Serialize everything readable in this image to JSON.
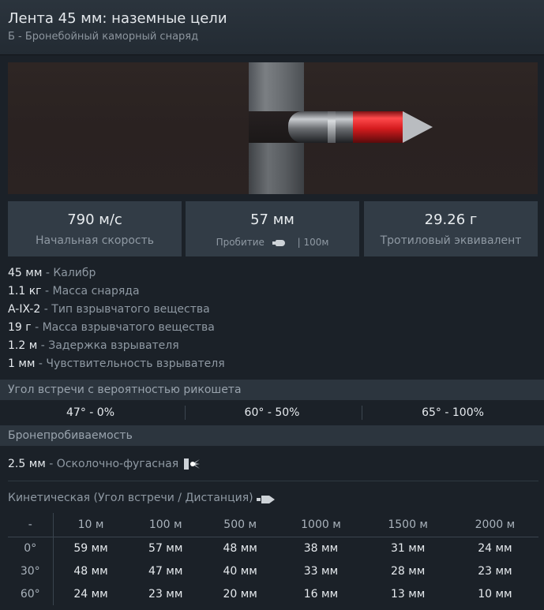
{
  "header": {
    "title": "Лента 45 мм: наземные цели",
    "subtitle": "Б - Бронебойный каморный снаряд"
  },
  "stats": [
    {
      "value": "790 м/с",
      "label": "Начальная скорость"
    },
    {
      "value": "57 мм",
      "label_prefix": "Пробитие",
      "label_suffix": "| 100м"
    },
    {
      "value": "29.26 г",
      "label": "Тротиловый эквивалент"
    }
  ],
  "properties": [
    {
      "value": "45 мм",
      "label": " - Калибр"
    },
    {
      "value": "1.1 кг",
      "label": " - Масса снаряда"
    },
    {
      "value": "A-IX-2",
      "label": " - Тип взрывчатого вещества"
    },
    {
      "value": "19 г",
      "label": " - Масса взрывчатого вещества"
    },
    {
      "value": "1.2 м",
      "label": " - Задержка взрывателя"
    },
    {
      "value": "1 мм",
      "label": " - Чувствительность взрывателя"
    }
  ],
  "ricochet": {
    "title": "Угол встречи с вероятностью рикошета",
    "cells": [
      {
        "angle": "47°",
        "prob": " - 0%"
      },
      {
        "angle": "60°",
        "prob": " - 50%"
      },
      {
        "angle": "65°",
        "prob": " - 100%"
      }
    ]
  },
  "armor": {
    "title": "Бронепробиваемость",
    "he_value": "2.5 мм",
    "he_label": " - Осколочно-фугасная",
    "kinetic_title": "Кинетическая (Угол встречи / Дистанция)",
    "table": {
      "corner": "-",
      "distances": [
        "10 м",
        "100 м",
        "500 м",
        "1000 м",
        "1500 м",
        "2000 м"
      ],
      "rows": [
        {
          "angle": "0°",
          "values": [
            "59 мм",
            "57 мм",
            "48 мм",
            "38 мм",
            "31 мм",
            "24 мм"
          ]
        },
        {
          "angle": "30°",
          "values": [
            "48 мм",
            "47 мм",
            "40 мм",
            "33 мм",
            "28 мм",
            "23 мм"
          ]
        },
        {
          "angle": "60°",
          "values": [
            "24 мм",
            "23 мм",
            "20 мм",
            "16 мм",
            "13 мм",
            "10 мм"
          ]
        }
      ]
    }
  },
  "icons": {
    "penetration": "shell-penetration-icon",
    "explosion": "he-explosion-icon",
    "kinetic": "kinetic-shell-icon"
  }
}
